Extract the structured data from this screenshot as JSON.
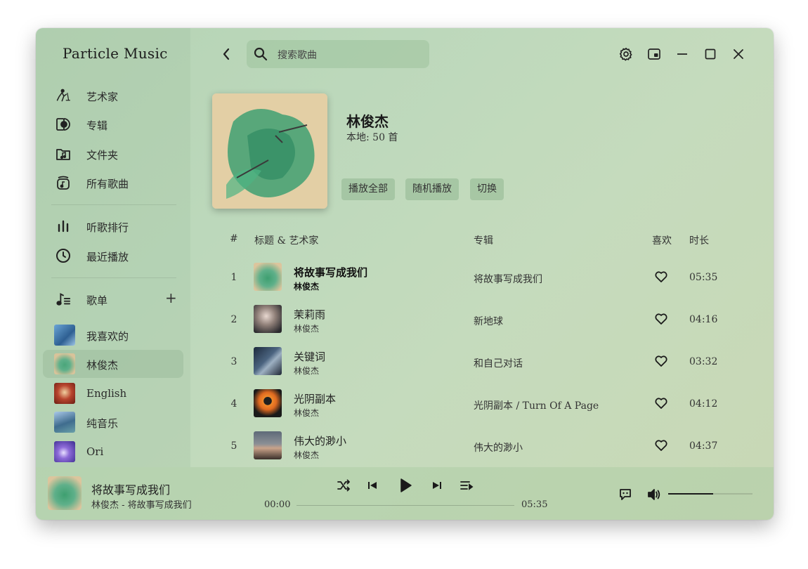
{
  "app": {
    "title": "Particle Music"
  },
  "sidebar": {
    "nav": [
      {
        "label": "艺术家",
        "icon": "artist-icon"
      },
      {
        "label": "专辑",
        "icon": "album-icon"
      },
      {
        "label": "文件夹",
        "icon": "folder-icon"
      },
      {
        "label": "所有歌曲",
        "icon": "all-songs-icon"
      }
    ],
    "nav2": [
      {
        "label": "听歌排行",
        "icon": "ranking-icon"
      },
      {
        "label": "最近播放",
        "icon": "clock-icon"
      }
    ],
    "playlists_header": {
      "label": "歌单",
      "add": "+"
    },
    "playlists": [
      {
        "label": "我喜欢的"
      },
      {
        "label": "林俊杰",
        "active": true
      },
      {
        "label": "English"
      },
      {
        "label": "纯音乐"
      },
      {
        "label": "Ori"
      }
    ]
  },
  "search": {
    "placeholder": "搜索歌曲"
  },
  "header": {
    "artist": "林俊杰",
    "subtitle": "本地: 50 首",
    "buttons": {
      "play_all": "播放全部",
      "shuffle": "随机播放",
      "switch": "切换"
    }
  },
  "table": {
    "headers": {
      "num": "#",
      "title": "标题 & 艺术家",
      "album": "专辑",
      "like": "喜欢",
      "duration": "时长"
    },
    "rows": [
      {
        "num": "1",
        "title": "将故事写成我们",
        "artist": "林俊杰",
        "album": "将故事写成我们",
        "duration": "05:35",
        "playing": true
      },
      {
        "num": "2",
        "title": "茉莉雨",
        "artist": "林俊杰",
        "album": "新地球",
        "duration": "04:16"
      },
      {
        "num": "3",
        "title": "关键词",
        "artist": "林俊杰",
        "album": "和自己对话",
        "duration": "03:32"
      },
      {
        "num": "4",
        "title": "光阴副本",
        "artist": "林俊杰",
        "album": "光阴副本 / Turn Of A Page",
        "duration": "04:12"
      },
      {
        "num": "5",
        "title": "伟大的渺小",
        "artist": "林俊杰",
        "album": "伟大的渺小",
        "duration": "04:37"
      }
    ]
  },
  "player": {
    "title": "将故事写成我们",
    "subtitle": "林俊杰 - 将故事写成我们",
    "elapsed": "00:00",
    "total": "05:35",
    "progress": 0.0,
    "volume": 0.53
  },
  "colors": {
    "accent": "#1a1a1a",
    "background": "#bcd8bb"
  }
}
